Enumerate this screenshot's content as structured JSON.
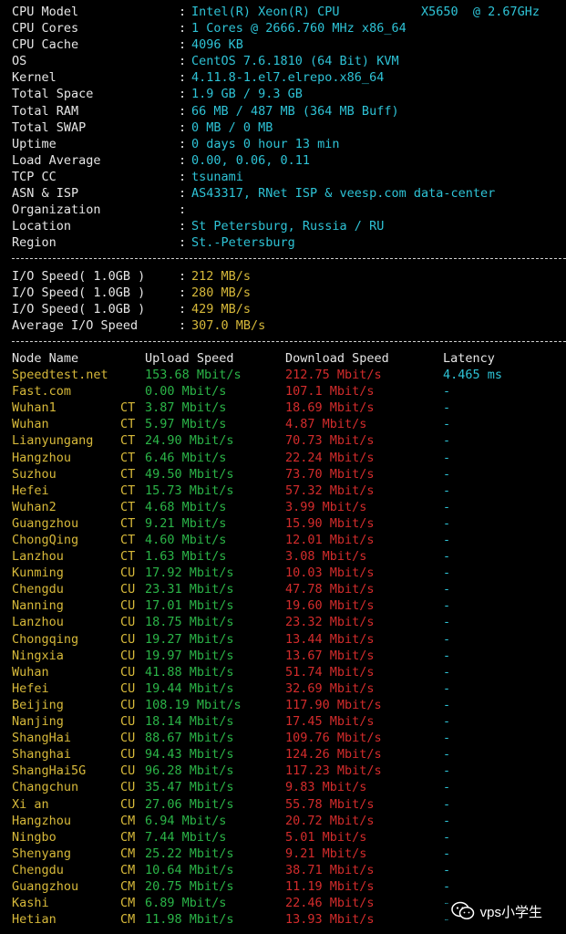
{
  "sysinfo": [
    {
      "label": "CPU Model",
      "value": "Intel(R) Xeon(R) CPU           X5650  @ 2.67GHz"
    },
    {
      "label": "CPU Cores",
      "value": "1 Cores @ 2666.760 MHz x86_64"
    },
    {
      "label": "CPU Cache",
      "value": "4096 KB"
    },
    {
      "label": "OS",
      "value": "CentOS 7.6.1810 (64 Bit) KVM"
    },
    {
      "label": "Kernel",
      "value": "4.11.8-1.el7.elrepo.x86_64"
    },
    {
      "label": "Total Space",
      "value": "1.9 GB / 9.3 GB"
    },
    {
      "label": "Total RAM",
      "value": "66 MB / 487 MB (364 MB Buff)"
    },
    {
      "label": "Total SWAP",
      "value": "0 MB / 0 MB"
    },
    {
      "label": "Uptime",
      "value": "0 days 0 hour 13 min"
    },
    {
      "label": "Load Average",
      "value": "0.00, 0.06, 0.11"
    },
    {
      "label": "TCP CC",
      "value": "tsunami"
    },
    {
      "label": "ASN & ISP",
      "value": "AS43317, RNet ISP & veesp.com data-center"
    },
    {
      "label": "Organization",
      "value": ""
    },
    {
      "label": "Location",
      "value": "St Petersburg, Russia / RU"
    },
    {
      "label": "Region",
      "value": "St.-Petersburg"
    }
  ],
  "io": [
    {
      "label": "I/O Speed( 1.0GB )",
      "value": "212 MB/s"
    },
    {
      "label": "I/O Speed( 1.0GB )",
      "value": "280 MB/s"
    },
    {
      "label": "I/O Speed( 1.0GB )",
      "value": "429 MB/s"
    },
    {
      "label": "Average I/O Speed",
      "value": "307.0 MB/s"
    }
  ],
  "colon": ":",
  "speed_header": {
    "node": "Node Name",
    "upload": "Upload Speed",
    "download": "Download Speed",
    "latency": "Latency"
  },
  "speed_rows": [
    {
      "node": "Speedtest.net",
      "isp": "",
      "up": "153.68 Mbit/s",
      "down": "212.75 Mbit/s",
      "lat": "4.465 ms"
    },
    {
      "node": "Fast.com",
      "isp": "",
      "up": "0.00 Mbit/s",
      "down": "107.1 Mbit/s",
      "lat": "-"
    },
    {
      "node": "Wuhan1",
      "isp": "CT",
      "up": "3.87 Mbit/s",
      "down": "18.69 Mbit/s",
      "lat": "-"
    },
    {
      "node": "Wuhan",
      "isp": "CT",
      "up": "5.97 Mbit/s",
      "down": "4.87 Mbit/s",
      "lat": "-"
    },
    {
      "node": "Lianyungang",
      "isp": "CT",
      "up": "24.90 Mbit/s",
      "down": "70.73 Mbit/s",
      "lat": "-"
    },
    {
      "node": "Hangzhou",
      "isp": "CT",
      "up": "6.46 Mbit/s",
      "down": "22.24 Mbit/s",
      "lat": "-"
    },
    {
      "node": "Suzhou",
      "isp": "CT",
      "up": "49.50 Mbit/s",
      "down": "73.70 Mbit/s",
      "lat": "-"
    },
    {
      "node": "Hefei",
      "isp": "CT",
      "up": "15.73 Mbit/s",
      "down": "57.32 Mbit/s",
      "lat": "-"
    },
    {
      "node": "Wuhan2",
      "isp": "CT",
      "up": "4.68 Mbit/s",
      "down": "3.99 Mbit/s",
      "lat": "-"
    },
    {
      "node": "Guangzhou",
      "isp": "CT",
      "up": "9.21 Mbit/s",
      "down": "15.90 Mbit/s",
      "lat": "-"
    },
    {
      "node": "ChongQing",
      "isp": "CT",
      "up": "4.60 Mbit/s",
      "down": "12.01 Mbit/s",
      "lat": "-"
    },
    {
      "node": "Lanzhou",
      "isp": "CT",
      "up": "1.63 Mbit/s",
      "down": "3.08 Mbit/s",
      "lat": "-"
    },
    {
      "node": "Kunming",
      "isp": "CU",
      "up": "17.92 Mbit/s",
      "down": "10.03 Mbit/s",
      "lat": "-"
    },
    {
      "node": "Chengdu",
      "isp": "CU",
      "up": "23.31 Mbit/s",
      "down": "47.78 Mbit/s",
      "lat": "-"
    },
    {
      "node": "Nanning",
      "isp": "CU",
      "up": "17.01 Mbit/s",
      "down": "19.60 Mbit/s",
      "lat": "-"
    },
    {
      "node": "Lanzhou",
      "isp": "CU",
      "up": "18.75 Mbit/s",
      "down": "23.32 Mbit/s",
      "lat": "-"
    },
    {
      "node": "Chongqing",
      "isp": "CU",
      "up": "19.27 Mbit/s",
      "down": "13.44 Mbit/s",
      "lat": "-"
    },
    {
      "node": "Ningxia",
      "isp": "CU",
      "up": "19.97 Mbit/s",
      "down": "13.67 Mbit/s",
      "lat": "-"
    },
    {
      "node": "Wuhan",
      "isp": "CU",
      "up": "41.88 Mbit/s",
      "down": "51.74 Mbit/s",
      "lat": "-"
    },
    {
      "node": "Hefei",
      "isp": "CU",
      "up": "19.44 Mbit/s",
      "down": "32.69 Mbit/s",
      "lat": "-"
    },
    {
      "node": "Beijing",
      "isp": "CU",
      "up": "108.19 Mbit/s",
      "down": "117.90 Mbit/s",
      "lat": "-"
    },
    {
      "node": "Nanjing",
      "isp": "CU",
      "up": "18.14 Mbit/s",
      "down": "17.45 Mbit/s",
      "lat": "-"
    },
    {
      "node": "ShangHai",
      "isp": "CU",
      "up": "88.67 Mbit/s",
      "down": "109.76 Mbit/s",
      "lat": "-"
    },
    {
      "node": "Shanghai",
      "isp": "CU",
      "up": "94.43 Mbit/s",
      "down": "124.26 Mbit/s",
      "lat": "-"
    },
    {
      "node": "ShangHai5G",
      "isp": "CU",
      "up": "96.28 Mbit/s",
      "down": "117.23 Mbit/s",
      "lat": "-"
    },
    {
      "node": "Changchun",
      "isp": "CU",
      "up": "35.47 Mbit/s",
      "down": "9.83 Mbit/s",
      "lat": "-"
    },
    {
      "node": "Xi an",
      "isp": "CU",
      "up": "27.06 Mbit/s",
      "down": "55.78 Mbit/s",
      "lat": "-"
    },
    {
      "node": "Hangzhou",
      "isp": "CM",
      "up": "6.94 Mbit/s",
      "down": "20.72 Mbit/s",
      "lat": "-"
    },
    {
      "node": "Ningbo",
      "isp": "CM",
      "up": "7.44 Mbit/s",
      "down": "5.01 Mbit/s",
      "lat": "-"
    },
    {
      "node": "Shenyang",
      "isp": "CM",
      "up": "25.22 Mbit/s",
      "down": "9.21 Mbit/s",
      "lat": "-"
    },
    {
      "node": "Chengdu",
      "isp": "CM",
      "up": "10.64 Mbit/s",
      "down": "38.71 Mbit/s",
      "lat": "-"
    },
    {
      "node": "Guangzhou",
      "isp": "CM",
      "up": "20.75 Mbit/s",
      "down": "11.19 Mbit/s",
      "lat": "-"
    },
    {
      "node": "Kashi",
      "isp": "CM",
      "up": "6.89 Mbit/s",
      "down": "22.46 Mbit/s",
      "lat": "-"
    },
    {
      "node": "Hetian",
      "isp": "CM",
      "up": "11.98 Mbit/s",
      "down": "13.93 Mbit/s",
      "lat": "-"
    }
  ],
  "watermark": {
    "text": "vps小学生",
    "icon": "wechat-icon"
  },
  "colors": {
    "background": "#000000",
    "label": "#e6e6e6",
    "value": "#2ec3d6",
    "node": "#d7b93a",
    "upload": "#2bb548",
    "download": "#d42c2c",
    "latency": "#2ec3d6"
  }
}
